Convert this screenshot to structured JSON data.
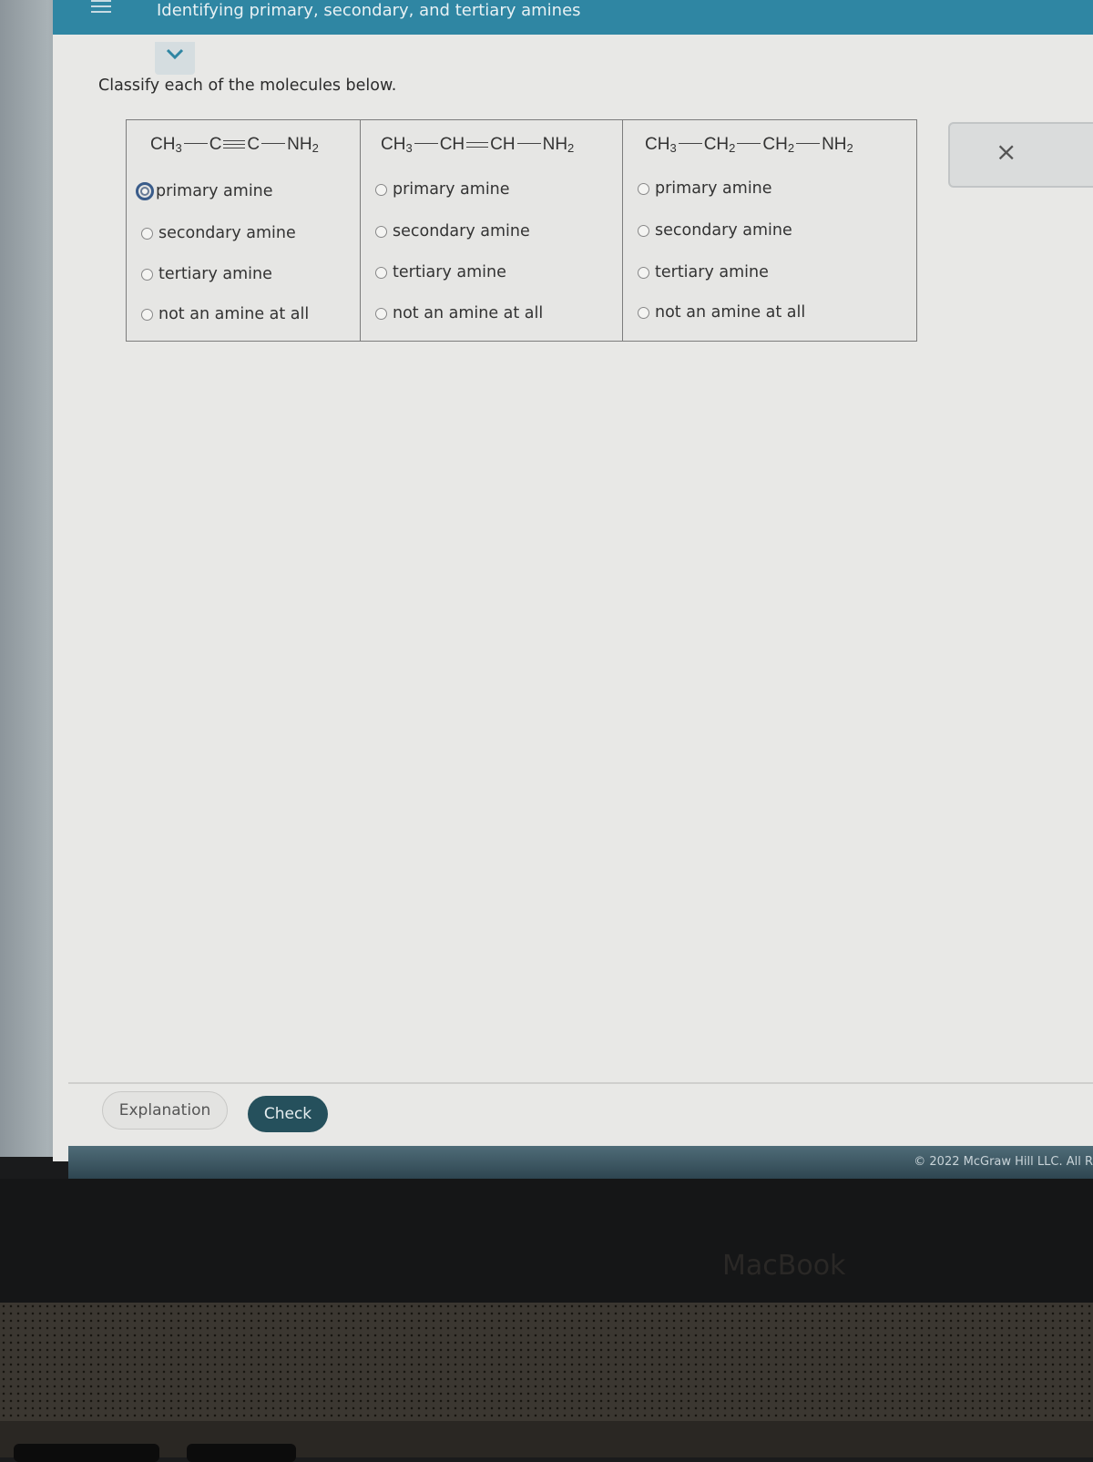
{
  "header": {
    "menu_icon": "hamburger-menu-icon",
    "title": "Identifying primary, secondary, and tertiary amines",
    "collapse_icon": "chevron-down-icon"
  },
  "instructions": "Classify each of the molecules below.",
  "molecules": [
    {
      "formula_parts": [
        "CH",
        "3",
        "C",
        "C",
        "NH",
        "2"
      ],
      "bond_types": [
        "single",
        "triple",
        "single"
      ],
      "options": [
        "primary amine",
        "secondary amine",
        "tertiary amine",
        "not an amine at all"
      ],
      "selected": "primary amine"
    },
    {
      "formula_parts": [
        "CH",
        "3",
        "CH",
        "CH",
        "NH",
        "2"
      ],
      "bond_types": [
        "single",
        "double",
        "single"
      ],
      "options": [
        "primary amine",
        "secondary amine",
        "tertiary amine",
        "not an amine at all"
      ],
      "selected": null
    },
    {
      "formula_parts": [
        "CH",
        "3",
        "CH",
        "2",
        "CH",
        "2",
        "NH",
        "2"
      ],
      "bond_types": [
        "single",
        "single",
        "single"
      ],
      "options": [
        "primary amine",
        "secondary amine",
        "tertiary amine",
        "not an amine at all"
      ],
      "selected": null
    }
  ],
  "close_button": {
    "icon": "close-icon",
    "label": "×"
  },
  "buttons": {
    "explanation": "Explanation",
    "check": "Check"
  },
  "footer": {
    "copyright": "© 2022 McGraw Hill LLC. All R"
  },
  "device": {
    "brand": "MacBook"
  }
}
